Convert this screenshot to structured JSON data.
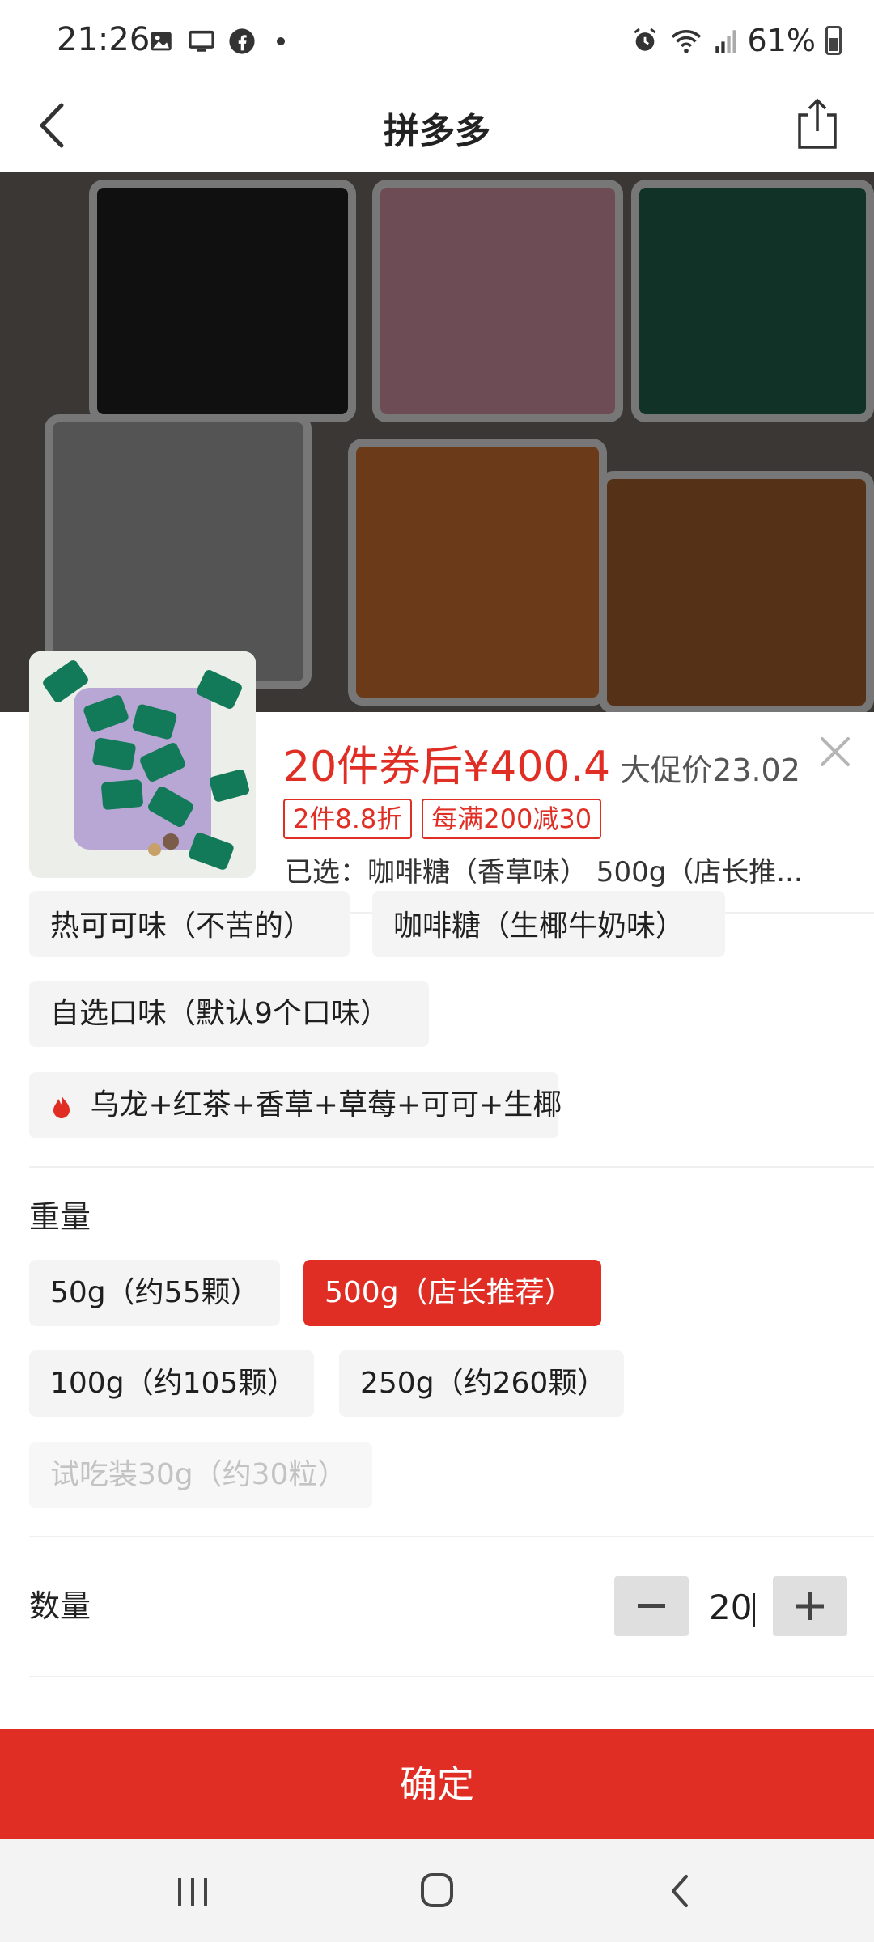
{
  "status_bar": {
    "time": "21:26",
    "battery": "61%",
    "left_icons": [
      "image-icon",
      "screen-cast-icon",
      "facebook-icon",
      "dot-icon"
    ],
    "right_icons": [
      "alarm-icon",
      "wifi-icon",
      "signal-icon",
      "battery-icon"
    ]
  },
  "header": {
    "title": "拼多多"
  },
  "product": {
    "price_main": "20件券后¥400.4",
    "price_original": "大促价23.02",
    "coupons": [
      "2件8.8折",
      "每满200减30"
    ],
    "selected": "已选：咖啡糖（香草味） 500g（店长推..."
  },
  "flavor_options": [
    {
      "label": "热可可味（不苦的）"
    },
    {
      "label": "咖啡糖（生椰牛奶味）"
    },
    {
      "label": "自选口味（默认9个口味）"
    },
    {
      "label": "乌龙+红茶+香草+草莓+可可+生椰"
    }
  ],
  "weight": {
    "label": "重量",
    "options": [
      {
        "label": "50g（约55颗）",
        "state": "normal"
      },
      {
        "label": "500g（店长推荐）",
        "state": "selected"
      },
      {
        "label": "100g（约105颗）",
        "state": "normal"
      },
      {
        "label": "250g（约260颗）",
        "state": "normal"
      },
      {
        "label": "试吃装30g（约30粒）",
        "state": "disabled"
      }
    ]
  },
  "quantity": {
    "label": "数量",
    "value": "20"
  },
  "confirm_label": "确定",
  "colors": {
    "accent": "#e02e24",
    "chip_bg": "#f4f4f4",
    "stepper_bg": "#dfdfdf"
  }
}
